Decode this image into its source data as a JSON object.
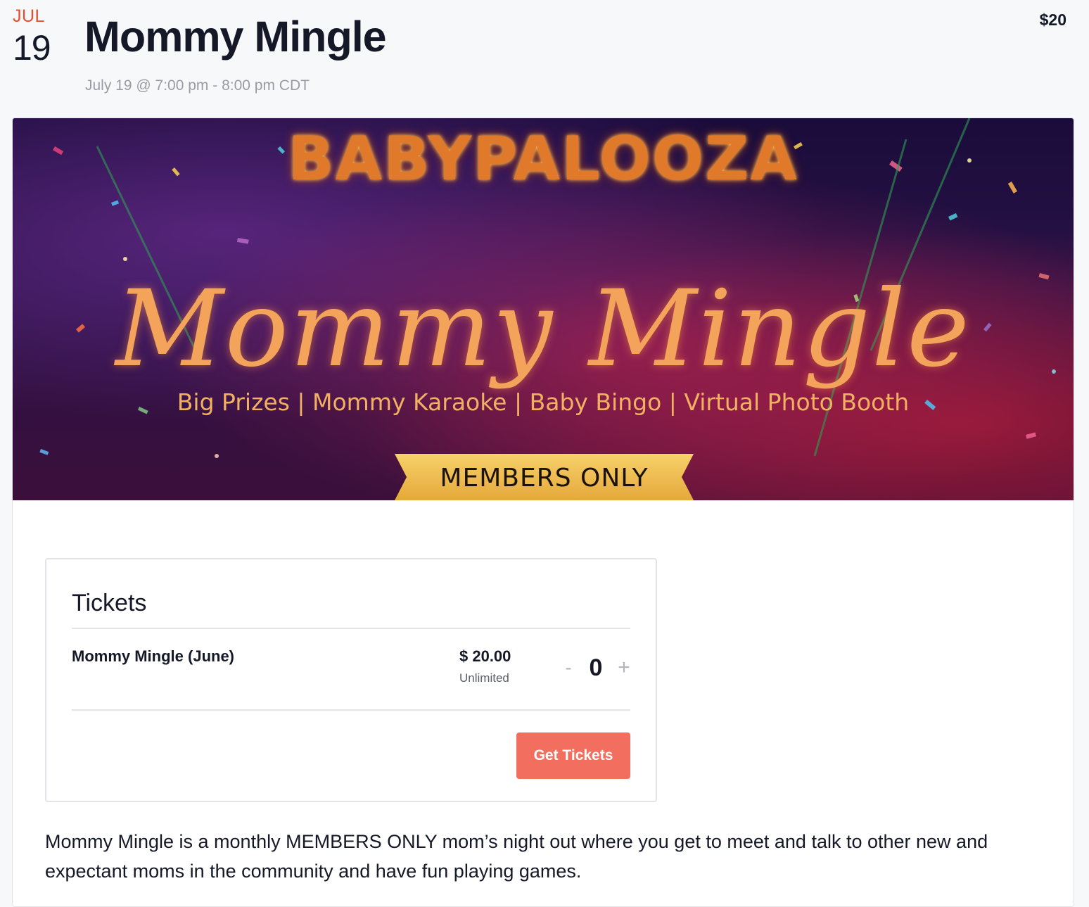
{
  "event": {
    "month": "JUL",
    "day": "19",
    "title": "Mommy Mingle",
    "time_range": "July 19 @ 7:00 pm - 8:00 pm CDT",
    "price": "$20"
  },
  "banner": {
    "brand": "BABYPALOOZA",
    "script_title": "Mommy Mingle",
    "tagline": "Big Prizes | Mommy Karaoke | Baby Bingo | Virtual Photo Booth",
    "ribbon": "MEMBERS ONLY"
  },
  "tickets": {
    "heading": "Tickets",
    "items": [
      {
        "name": "Mommy Mingle (June)",
        "price": "$ 20.00",
        "availability": "Unlimited",
        "quantity": "0",
        "decrement_label": "-",
        "increment_label": "+"
      }
    ],
    "submit_label": "Get Tickets"
  },
  "description": "Mommy Mingle is a monthly MEMBERS ONLY mom’s night out where you get to meet and talk to other new and expectant moms in the community and have fun playing games.",
  "colors": {
    "accent_month": "#e4502f",
    "button": "#f26e5f",
    "text_primary": "#141827",
    "text_muted": "#9a9ca4"
  }
}
